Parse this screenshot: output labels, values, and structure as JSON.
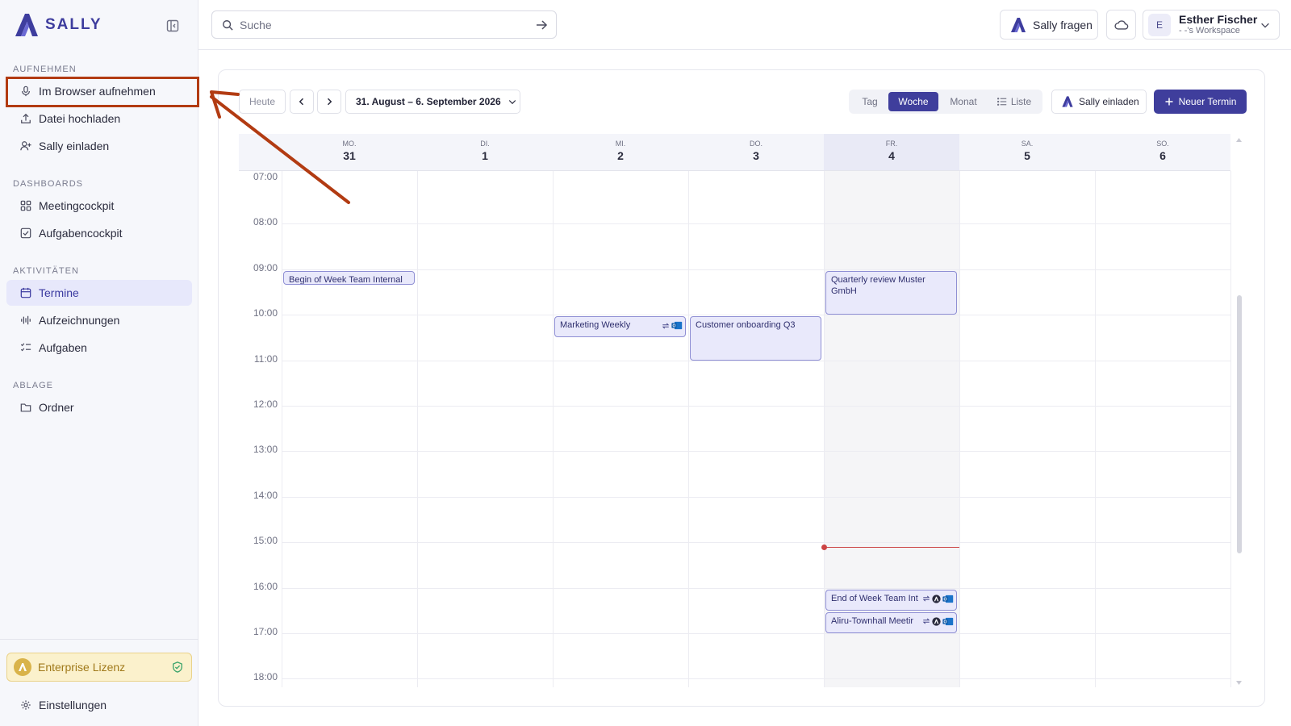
{
  "brand": {
    "name": "SALLY",
    "color": "#3e3d9e"
  },
  "sidebar": {
    "sections": [
      {
        "label": "AUFNEHMEN"
      },
      {
        "label": "DASHBOARDS"
      },
      {
        "label": "AKTIVITÄTEN"
      },
      {
        "label": "ABLAGE"
      }
    ],
    "items": [
      {
        "label": "Im Browser aufnehmen",
        "icon": "microphone-icon"
      },
      {
        "label": "Datei hochladen",
        "icon": "upload-icon"
      },
      {
        "label": "Sally einladen",
        "icon": "user-plus-icon"
      },
      {
        "label": "Meetingcockpit",
        "icon": "grid-icon"
      },
      {
        "label": "Aufgabencockpit",
        "icon": "checkbox-icon"
      },
      {
        "label": "Termine",
        "icon": "calendar-icon",
        "active": true
      },
      {
        "label": "Aufzeichnungen",
        "icon": "waveform-icon"
      },
      {
        "label": "Aufgaben",
        "icon": "checklist-icon"
      },
      {
        "label": "Ordner",
        "icon": "folder-icon"
      }
    ],
    "enterprise_label": "Enterprise Lizenz",
    "settings_label": "Einstellungen"
  },
  "topbar": {
    "search_placeholder": "Suche",
    "ask_label": "Sally fragen",
    "user": {
      "initial": "E",
      "name": "Esther Fischer",
      "workspace": "- -'s Workspace"
    }
  },
  "calendar": {
    "today_label": "Heute",
    "range_label": "31. August – 6. September 2026",
    "views": [
      "Tag",
      "Woche",
      "Monat",
      "Liste"
    ],
    "active_view": "Woche",
    "invite_label": "Sally einladen",
    "new_label": "Neuer Termin",
    "days": [
      {
        "dow": "MO.",
        "num": "31"
      },
      {
        "dow": "DI.",
        "num": "1"
      },
      {
        "dow": "MI.",
        "num": "2"
      },
      {
        "dow": "DO.",
        "num": "3"
      },
      {
        "dow": "FR.",
        "num": "4",
        "today": true
      },
      {
        "dow": "SA.",
        "num": "5"
      },
      {
        "dow": "SO.",
        "num": "6"
      }
    ],
    "hours": [
      "07:00",
      "08:00",
      "09:00",
      "10:00",
      "11:00",
      "12:00",
      "13:00",
      "14:00",
      "15:00",
      "16:00",
      "17:00",
      "18:00"
    ],
    "events": [
      {
        "title": "Begin of Week Team Internal",
        "day": 0,
        "start": "09:00",
        "end": "09:20"
      },
      {
        "title": "Marketing Weekly",
        "day": 2,
        "start": "10:00",
        "end": "10:30",
        "icons": [
          "repeat-icon",
          "outlook-icon"
        ]
      },
      {
        "title": "Customer onboarding Q3",
        "day": 3,
        "start": "10:00",
        "end": "11:00"
      },
      {
        "title": "Quarterly review Muster GmbH",
        "day": 4,
        "start": "09:00",
        "end": "10:00"
      },
      {
        "title": "End of Week Team Int",
        "day": 4,
        "start": "16:00",
        "end": "16:30",
        "icons": [
          "repeat-icon",
          "sally-icon",
          "outlook-icon"
        ]
      },
      {
        "title": "Aliru-Townhall Meetir",
        "day": 4,
        "start": "16:30",
        "end": "17:00",
        "icons": [
          "repeat-icon",
          "sally-icon",
          "outlook-icon"
        ]
      }
    ],
    "now_time": "15:05",
    "colors": {
      "accent": "#3f3e9c",
      "event_bg": "#e9e9fb",
      "event_border": "#8f8fd4",
      "now": "#cc4444",
      "annotation": "#b23b12"
    }
  }
}
